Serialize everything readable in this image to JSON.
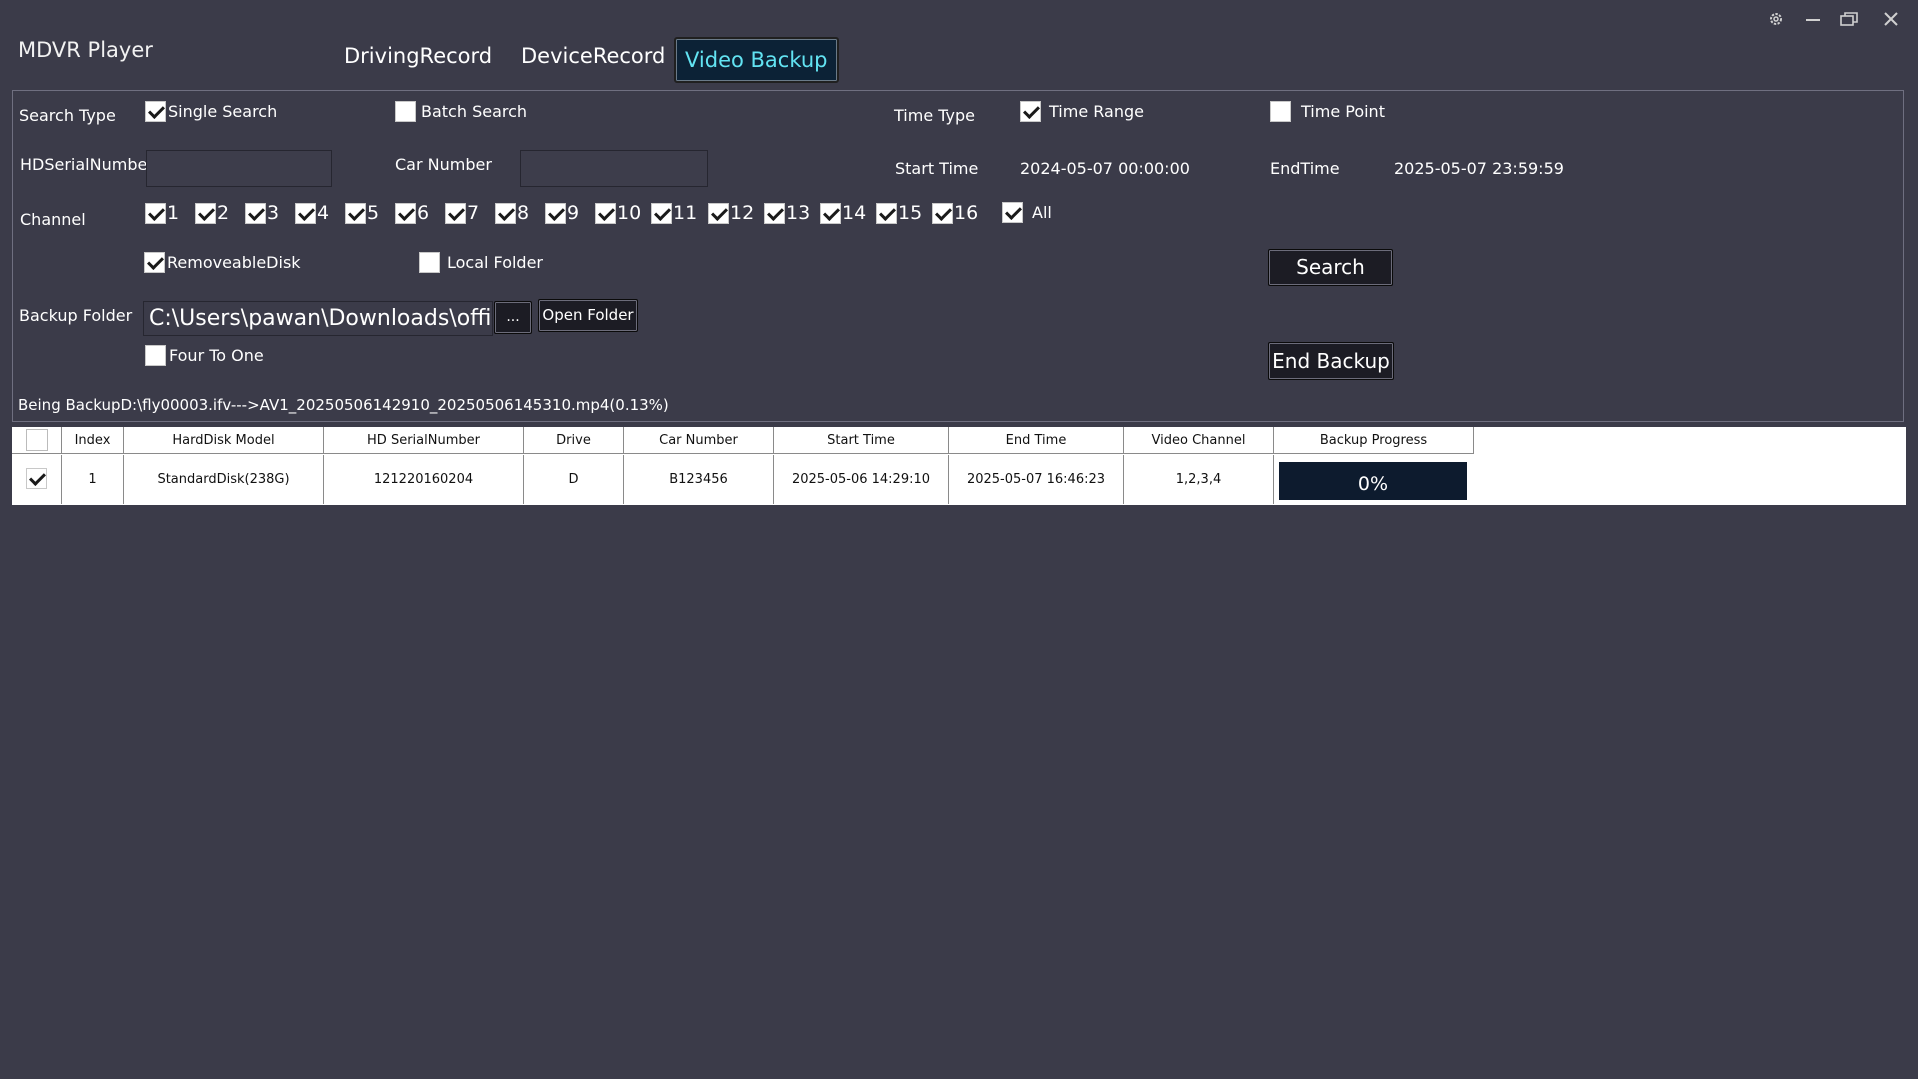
{
  "app": {
    "title": "MDVR Player"
  },
  "tabs": [
    {
      "label": "DrivingRecord"
    },
    {
      "label": "DeviceRecord"
    },
    {
      "label": "Video Backup",
      "active": true
    }
  ],
  "window_controls": {
    "settings_icon": "gear-icon",
    "minimize_icon": "minimize-icon",
    "restore_icon": "restore-icon",
    "close_icon": "close-icon"
  },
  "search_type": {
    "label": "Search Type",
    "single": {
      "label": "Single Search",
      "checked": true
    },
    "batch": {
      "label": "Batch Search",
      "checked": false
    }
  },
  "time_type": {
    "label": "Time Type",
    "range": {
      "label": "Time Range",
      "checked": true
    },
    "point": {
      "label": "Time Point",
      "checked": false
    }
  },
  "hd_serial": {
    "label": "HDSerialNumber",
    "value": ""
  },
  "car_number": {
    "label": "Car Number",
    "value": ""
  },
  "start_time": {
    "label": "Start Time",
    "value": "2024-05-07 00:00:00"
  },
  "end_time": {
    "label": "EndTime",
    "value": "2025-05-07 23:59:59"
  },
  "channel": {
    "label": "Channel",
    "items": [
      {
        "label": "1",
        "checked": true
      },
      {
        "label": "2",
        "checked": true
      },
      {
        "label": "3",
        "checked": true
      },
      {
        "label": "4",
        "checked": true
      },
      {
        "label": "5",
        "checked": true
      },
      {
        "label": "6",
        "checked": true
      },
      {
        "label": "7",
        "checked": true
      },
      {
        "label": "8",
        "checked": true
      },
      {
        "label": "9",
        "checked": true
      },
      {
        "label": "10",
        "checked": true
      },
      {
        "label": "11",
        "checked": true
      },
      {
        "label": "12",
        "checked": true
      },
      {
        "label": "13",
        "checked": true
      },
      {
        "label": "14",
        "checked": true
      },
      {
        "label": "15",
        "checked": true
      },
      {
        "label": "16",
        "checked": true
      }
    ],
    "all": {
      "label": "All",
      "checked": true
    }
  },
  "source": {
    "removeable": {
      "label": "RemoveableDisk",
      "checked": true
    },
    "local": {
      "label": "Local Folder",
      "checked": false
    }
  },
  "buttons": {
    "search": "Search",
    "end_backup": "End Backup",
    "browse": "...",
    "open_folder": "Open Folder"
  },
  "backup_folder": {
    "label": "Backup Folder",
    "value": "C:\\Users\\pawan\\Downloads\\office backup"
  },
  "four_to_one": {
    "label": "Four To One",
    "checked": false
  },
  "status": {
    "text": "Being BackupD:\\fly00003.ifv--->AV1_20250506142910_20250506145310.mp4(0.13%)"
  },
  "table": {
    "headers": [
      "Index",
      "HardDisk Model",
      "HD SerialNumber",
      "Drive",
      "Car Number",
      "Start Time",
      "End Time",
      "Video Channel",
      "Backup Progress"
    ],
    "rows": [
      {
        "checked": true,
        "index": "1",
        "model": "StandardDisk(238G)",
        "serial": "121220160204",
        "drive": "D",
        "car": "B123456",
        "start": "2025-05-06 14:29:10",
        "end": "2025-05-07 16:46:23",
        "channels": "1,2,3,4",
        "progress_label": "0%",
        "progress_value": 0
      }
    ]
  }
}
